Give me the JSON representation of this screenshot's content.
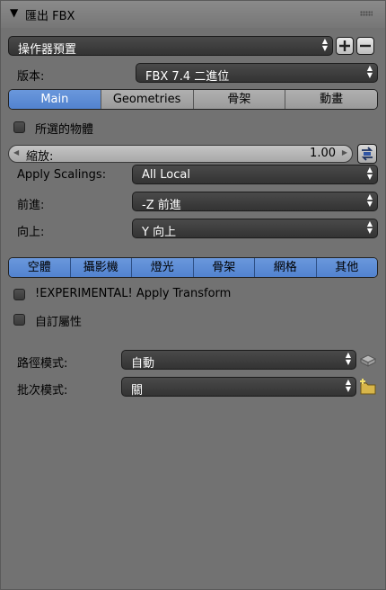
{
  "header": {
    "title": "匯出 FBX"
  },
  "operator_presets": {
    "value": "操作器預置"
  },
  "version": {
    "label": "版本:",
    "value": "FBX 7.4 二進位"
  },
  "main_tabs": [
    {
      "label": "Main",
      "selected": true
    },
    {
      "label": "Geometries",
      "selected": false
    },
    {
      "label": "骨架",
      "selected": false
    },
    {
      "label": "動畫",
      "selected": false
    }
  ],
  "selected_objects": {
    "label": "所選的物體",
    "checked": false
  },
  "scale": {
    "label": "縮放:",
    "value": "1.00"
  },
  "apply_scalings": {
    "label": "Apply Scalings:",
    "value": "All Local"
  },
  "forward": {
    "label": "前進:",
    "value": "-Z 前進"
  },
  "up": {
    "label": "向上:",
    "value": "Y 向上"
  },
  "object_types": [
    {
      "label": "空體"
    },
    {
      "label": "攝影機"
    },
    {
      "label": "燈光"
    },
    {
      "label": "骨架"
    },
    {
      "label": "網格"
    },
    {
      "label": "其他"
    }
  ],
  "apply_transform": {
    "label": "!EXPERIMENTAL! Apply Transform",
    "checked": false
  },
  "custom_props": {
    "label": "自訂屬性",
    "checked": false
  },
  "path_mode": {
    "label": "路徑模式:",
    "value": "自動"
  },
  "batch_mode": {
    "label": "批次模式:",
    "value": "關"
  },
  "colors": {
    "accent": "#5a8bd6",
    "panel": "#727272",
    "dropdown": "#3d3d3d"
  }
}
